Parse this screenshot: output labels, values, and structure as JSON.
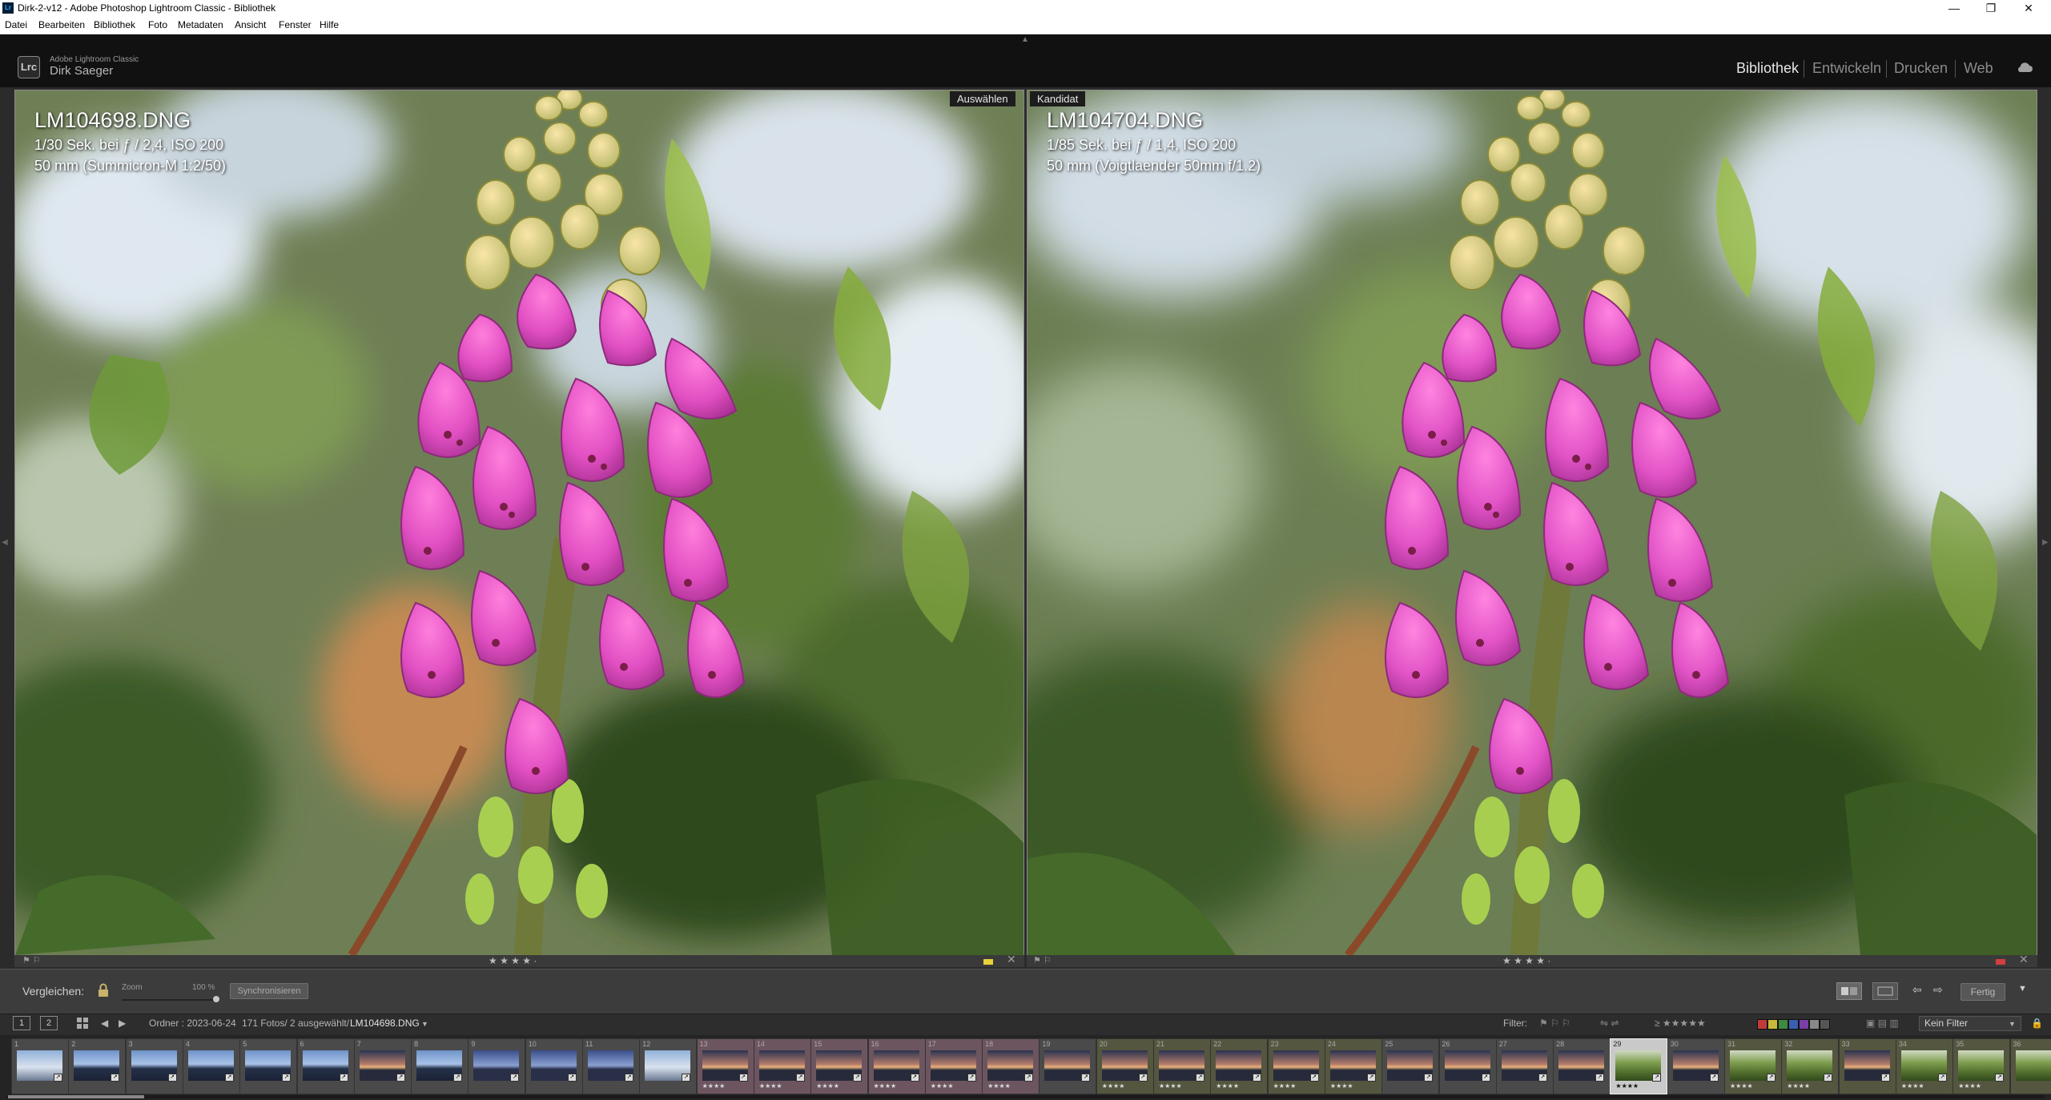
{
  "window": {
    "title": "Dirk-2-v12 - Adobe Photoshop Lightroom Classic - Bibliothek",
    "controls": [
      "—",
      "❐",
      "✕"
    ]
  },
  "menubar": [
    "Datei",
    "Bearbeiten",
    "Bibliothek",
    "Foto",
    "Metadaten",
    "Ansicht",
    "Fenster",
    "Hilfe"
  ],
  "identity": {
    "logo": "Lrc",
    "product": "Adobe Lightroom Classic",
    "user": "Dirk Saeger"
  },
  "modules": [
    {
      "label": "Bibliothek",
      "active": true
    },
    {
      "label": "Entwickeln",
      "active": false
    },
    {
      "label": "Drucken",
      "active": false
    },
    {
      "label": "Web",
      "active": false
    }
  ],
  "compare": {
    "select": {
      "tag": "Auswählen",
      "filename": "LM104698.DNG",
      "exposure": "1/30 Sek. bei ƒ / 2,4, ISO 200",
      "lens": "50 mm (Summicron-M 1:2/50)",
      "stars": "★ ★ ★ ★ ·",
      "color_label": "#e8d23a"
    },
    "candidate": {
      "tag": "Kandidat",
      "filename": "LM104704.DNG",
      "exposure": "1/85 Sek. bei ƒ / 1,4, ISO 200",
      "lens": "50 mm (Voigtlaender 50mm f/1.2)",
      "stars": "★ ★ ★ ★ ·",
      "color_label": "#d04040"
    }
  },
  "toolbar": {
    "compare_label": "Vergleichen:",
    "zoom_label": "Zoom",
    "zoom_value": "100 %",
    "zoom_level": 0.98,
    "sync_label": "Synchronisieren",
    "done_label": "Fertig"
  },
  "filmstrip_bar": {
    "screen1": "1",
    "screen2": "2",
    "path": "Ordner : 2023-06-24",
    "count": "171 Fotos/ 2 ausgewählt/",
    "current": "LM104698.DNG",
    "filter_label": "Filter:",
    "filter_value": "Kein Filter",
    "filter_stars": "≥ ★★★★★",
    "label_colors": [
      "#c23b3b",
      "#c9b93a",
      "#3f8a3f",
      "#3b5fb0",
      "#7a3fa8",
      "#888888",
      "#555555"
    ]
  },
  "filmstrip": [
    {
      "num": "1",
      "tone": "sky",
      "stars": ""
    },
    {
      "num": "2",
      "tone": "lake",
      "stars": ""
    },
    {
      "num": "3",
      "tone": "lake",
      "stars": ""
    },
    {
      "num": "4",
      "tone": "lake",
      "stars": ""
    },
    {
      "num": "5",
      "tone": "lake",
      "stars": ""
    },
    {
      "num": "6",
      "tone": "lake",
      "stars": ""
    },
    {
      "num": "7",
      "tone": "sunset",
      "stars": ""
    },
    {
      "num": "8",
      "tone": "lake",
      "stars": ""
    },
    {
      "num": "9",
      "tone": "dusk",
      "stars": ""
    },
    {
      "num": "10",
      "tone": "dusk",
      "stars": ""
    },
    {
      "num": "11",
      "tone": "dusk",
      "stars": ""
    },
    {
      "num": "12",
      "tone": "sky",
      "stars": ""
    },
    {
      "num": "13",
      "tone": "sunset",
      "stars": "★★★★"
    },
    {
      "num": "14",
      "tone": "sunset",
      "stars": "★★★★"
    },
    {
      "num": "15",
      "tone": "sunset",
      "stars": "★★★★"
    },
    {
      "num": "16",
      "tone": "sunset",
      "stars": "★★★★"
    },
    {
      "num": "17",
      "tone": "sunset",
      "stars": "★★★★"
    },
    {
      "num": "18",
      "tone": "sunset",
      "stars": "★★★★"
    },
    {
      "num": "19",
      "tone": "sunset",
      "stars": ""
    },
    {
      "num": "20",
      "tone": "sunset",
      "stars": "★★★★"
    },
    {
      "num": "21",
      "tone": "sunset",
      "stars": "★★★★"
    },
    {
      "num": "22",
      "tone": "sunset",
      "stars": "★★★★"
    },
    {
      "num": "23",
      "tone": "sunset",
      "stars": "★★★★"
    },
    {
      "num": "24",
      "tone": "sunset",
      "stars": "★★★★"
    },
    {
      "num": "25",
      "tone": "sunset",
      "stars": ""
    },
    {
      "num": "26",
      "tone": "sunset",
      "stars": ""
    },
    {
      "num": "27",
      "tone": "sunset",
      "stars": ""
    },
    {
      "num": "28",
      "tone": "sunset",
      "stars": ""
    },
    {
      "num": "29",
      "tone": "green",
      "stars": "★★★★"
    },
    {
      "num": "30",
      "tone": "sunset",
      "stars": ""
    },
    {
      "num": "31",
      "tone": "green",
      "stars": "★★★★"
    },
    {
      "num": "32",
      "tone": "green",
      "stars": "★★★★"
    },
    {
      "num": "33",
      "tone": "sunset",
      "stars": ""
    },
    {
      "num": "34",
      "tone": "green",
      "stars": "★★★★"
    },
    {
      "num": "35",
      "tone": "green",
      "stars": "★★★★"
    },
    {
      "num": "36",
      "tone": "green",
      "stars": ""
    }
  ]
}
